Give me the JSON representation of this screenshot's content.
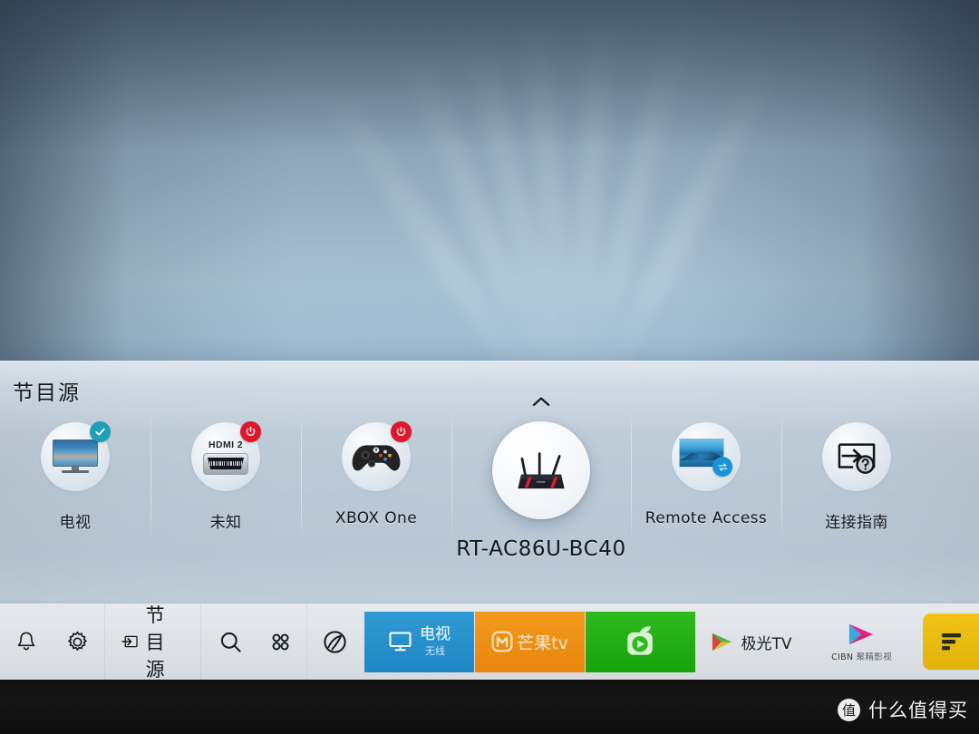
{
  "panel": {
    "title": "节目源",
    "sources": [
      {
        "label": "电视",
        "icon": "tv-icon",
        "badge": "check-badge",
        "selected": false
      },
      {
        "label": "未知",
        "icon": "hdmi-icon",
        "badge": "power-badge",
        "selected": false,
        "port_label": "HDMI 2"
      },
      {
        "label": "XBOX One",
        "icon": "gamepad-icon",
        "badge": "power-badge",
        "selected": false
      },
      {
        "label": "RT-AC86U-BC40",
        "icon": "router-icon",
        "badge": "",
        "selected": true
      },
      {
        "label": "Remote Access",
        "icon": "screen-share-icon",
        "badge": "",
        "selected": false
      },
      {
        "label": "连接指南",
        "icon": "connection-guide-icon",
        "badge": "",
        "selected": false
      }
    ]
  },
  "bottom_bar": {
    "icons": [
      {
        "name": "notification-bell-icon"
      },
      {
        "name": "settings-gear-icon"
      }
    ],
    "source_button": {
      "label": "节目源",
      "icon": "source-input-icon"
    },
    "tools": [
      {
        "name": "search-icon"
      },
      {
        "name": "apps-grid-icon"
      },
      {
        "name": "universal-guide-icon"
      }
    ],
    "apps": [
      {
        "name": "app-tv",
        "title": "电视",
        "subtitle": "无线",
        "color": "#2f9bd4"
      },
      {
        "name": "app-mango",
        "title": "芒果tv",
        "subtitle": "",
        "color": "#f29a1d"
      },
      {
        "name": "app-green",
        "title": "",
        "subtitle": "",
        "color": "#2fba1e"
      },
      {
        "name": "app-aurora",
        "title": "极光TV",
        "subtitle": "",
        "color": "#ffffff"
      },
      {
        "name": "app-cibn",
        "title": "CIBN",
        "subtitle": "聚精影视",
        "color": "#ffffff"
      },
      {
        "name": "app-yellow",
        "title": "",
        "subtitle": "",
        "color": "#f2c417"
      }
    ]
  },
  "watermark": {
    "logo": "值",
    "text": "什么值得买"
  },
  "colors": {
    "accent_check": "#1f9fb5",
    "accent_power": "#e0162b",
    "panel_bg": "#c3ced8",
    "bar_bg": "#e1e5e9"
  }
}
